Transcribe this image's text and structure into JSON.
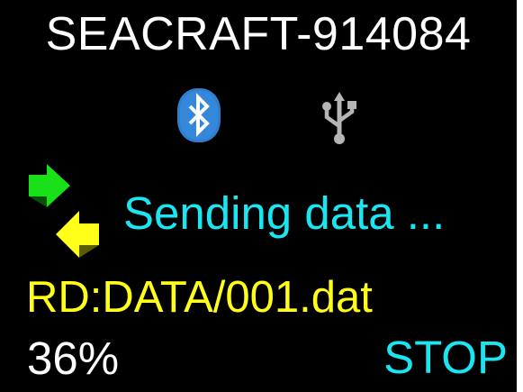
{
  "device": {
    "title": "SEACRAFT-914084"
  },
  "icons": {
    "bluetooth": "bluetooth-icon",
    "usb": "usb-icon",
    "transfer": "transfer-arrows-icon"
  },
  "status": {
    "message": "Sending data ...",
    "file": "RD:DATA/001.dat",
    "progress_text": "36%",
    "progress_percent": 36
  },
  "controls": {
    "stop_label": "STOP"
  },
  "colors": {
    "background": "#000000",
    "title": "#ffffff",
    "status": "#19e6f0",
    "file": "#ffff19",
    "progress": "#ffffff",
    "stop": "#19e6f0",
    "bluetooth": "#2f7fd0",
    "usb": "#b5b5b5",
    "arrow_green": "#19e019",
    "arrow_yellow": "#ffff19"
  }
}
